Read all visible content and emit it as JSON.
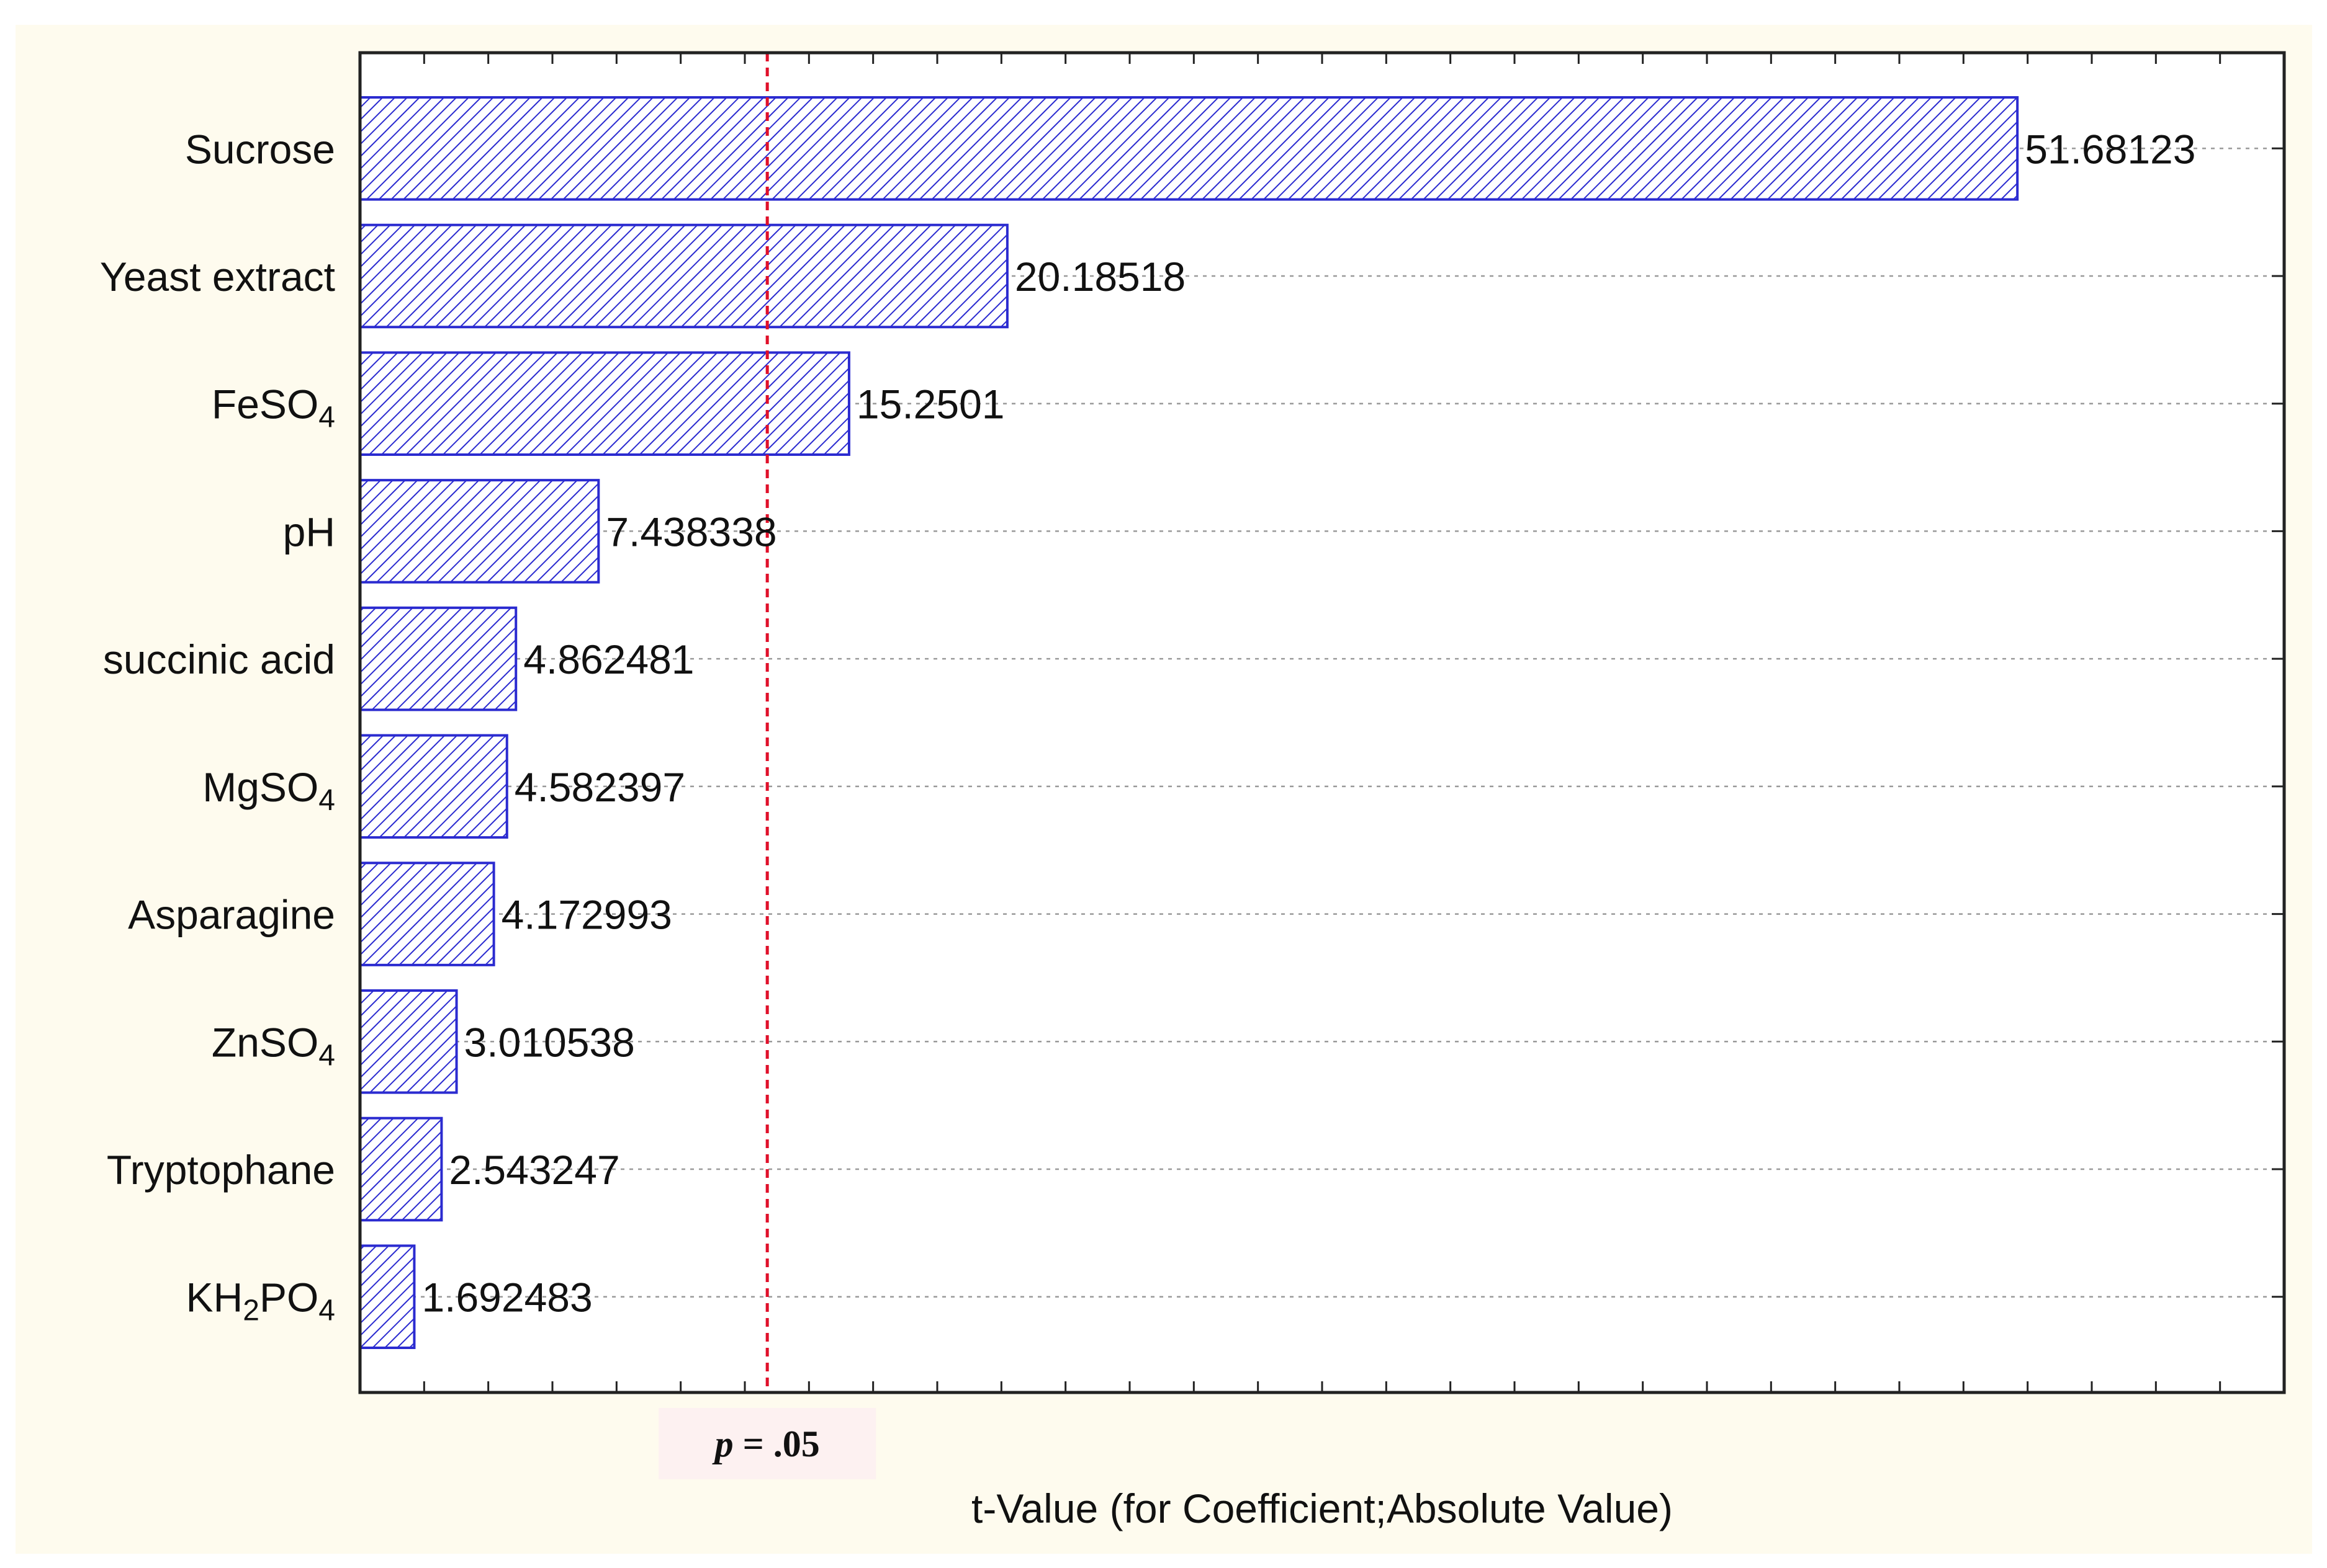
{
  "chart_data": {
    "type": "bar",
    "orientation": "horizontal",
    "title": "",
    "xlabel": "t-Value (for Coefficient;Absolute Value)",
    "ylabel": "",
    "categories": [
      {
        "base": "Sucrose"
      },
      {
        "base": "Yeast extract"
      },
      {
        "base": "FeSO",
        "sub": "4"
      },
      {
        "base": "pH"
      },
      {
        "base": "succinic acid"
      },
      {
        "base": "MgSO",
        "sub": "4"
      },
      {
        "base": "Asparagine"
      },
      {
        "base": "ZnSO",
        "sub": "4"
      },
      {
        "base": "Tryptophane"
      },
      {
        "base": "KH",
        "sub": "2",
        "mid": "PO",
        "sub2": "4"
      }
    ],
    "values": [
      51.68123,
      20.18518,
      15.2501,
      7.438338,
      4.862481,
      4.582397,
      4.172993,
      3.010538,
      2.543247,
      1.692483
    ],
    "value_labels": [
      "51.68123",
      "20.18518",
      "15.2501",
      "7.438338",
      "4.862481",
      "4.582397",
      "4.172993",
      "3.010538",
      "2.543247",
      "1.692483"
    ],
    "xlim": [
      0,
      60
    ],
    "x_tick_count": 30,
    "threshold": {
      "value": 12.7,
      "label_prefix": "p",
      "label_suffix": " = .05",
      "color": "#e0102a"
    },
    "grid": true,
    "bar_color": "#2b2bd0",
    "bar_fill": "hatched",
    "background": "#fefbee"
  }
}
